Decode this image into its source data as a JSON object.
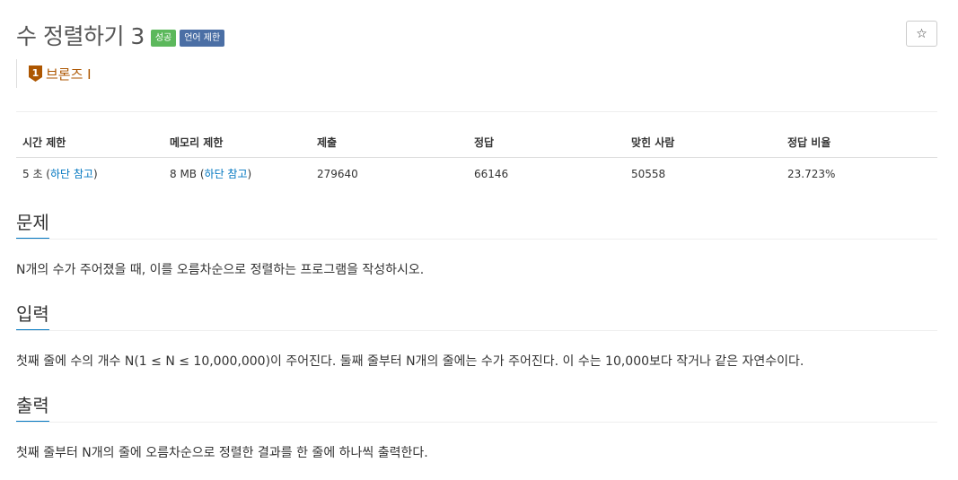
{
  "problem": {
    "title": "수 정렬하기 3",
    "badges": {
      "success": "성공",
      "language": "언어 제한"
    },
    "tier": {
      "number": "1",
      "label": "브론즈 I",
      "color": "#ad5600"
    }
  },
  "star_icon": "☆",
  "info_table": {
    "headers": [
      "시간 제한",
      "메모리 제한",
      "제출",
      "정답",
      "맞힌 사람",
      "정답 비율"
    ],
    "time_limit": {
      "value": "5 초 (",
      "link": "하단 참고",
      "close": ")"
    },
    "memory_limit": {
      "value": "8 MB (",
      "link": "하단 참고",
      "close": ")"
    },
    "submissions": "279640",
    "accepted": "66146",
    "solvers": "50558",
    "ratio": "23.723%"
  },
  "sections": {
    "problem": {
      "title": "문제",
      "text": "N개의 수가 주어졌을 때, 이를 오름차순으로 정렬하는 프로그램을 작성하시오."
    },
    "input": {
      "title": "입력",
      "text": "첫째 줄에 수의 개수 N(1 ≤ N ≤ 10,000,000)이 주어진다. 둘째 줄부터 N개의 줄에는 수가 주어진다. 이 수는 10,000보다 작거나 같은 자연수이다."
    },
    "output": {
      "title": "출력",
      "text": "첫째 줄부터 N개의 줄에 오름차순으로 정렬한 결과를 한 줄에 하나씩 출력한다."
    }
  },
  "colors": {
    "success_badge": "#5cb85c",
    "language_badge": "#4b6fa5",
    "link": "#0076c0",
    "bronze": "#ad5600"
  }
}
